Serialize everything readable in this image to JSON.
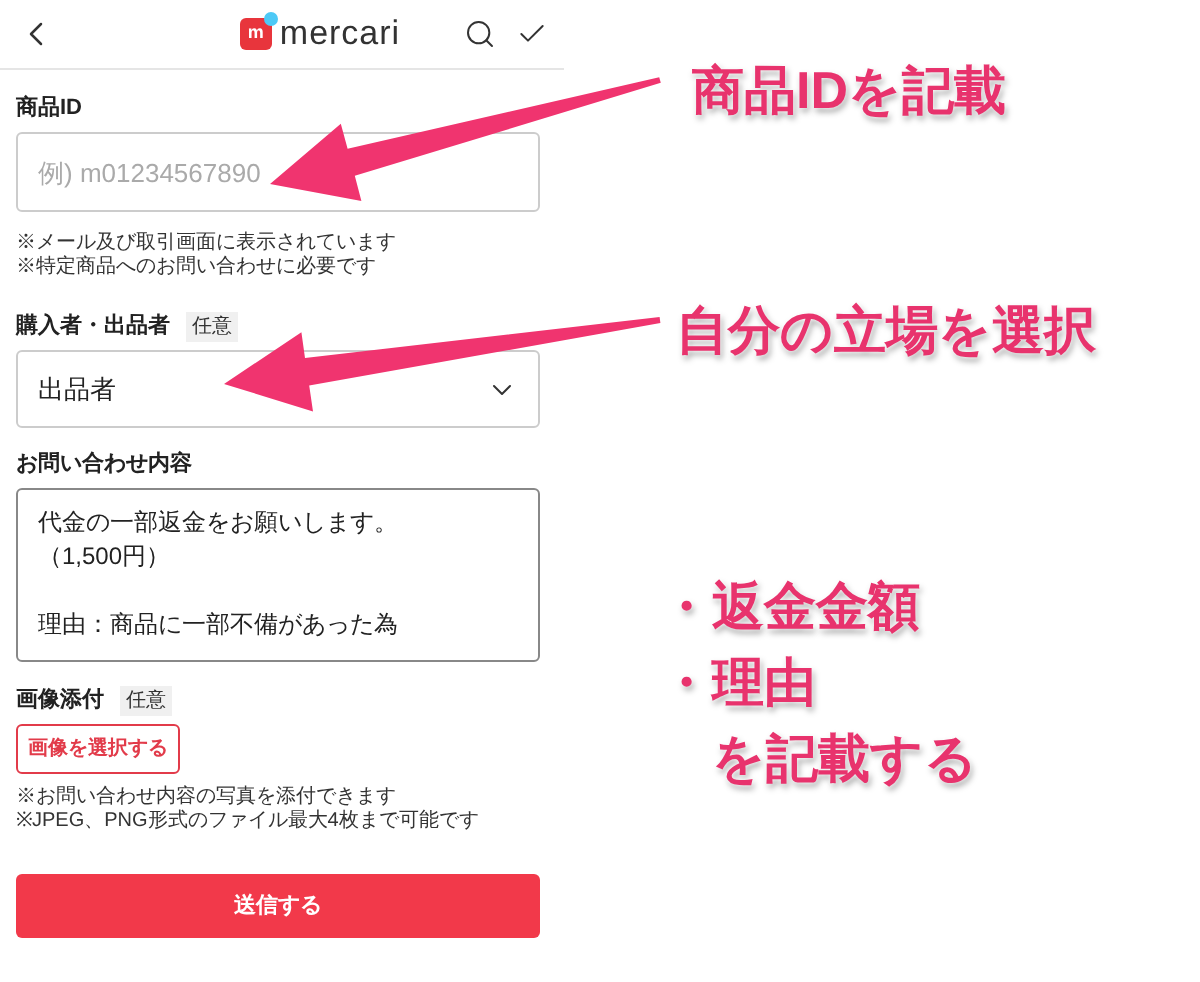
{
  "header": {
    "logo_mark": "m",
    "logo_text": "mercari"
  },
  "form": [
    {
      "kind": "input",
      "label": "商品ID",
      "placeholder": "例) m01234567890",
      "notes": [
        "※メール及び取引画面に表示されています",
        "※特定商品へのお問い合わせに必要です"
      ]
    },
    {
      "kind": "select",
      "label": "購入者・出品者",
      "badge": "任意",
      "value": "出品者"
    },
    {
      "kind": "textarea",
      "label": "お問い合わせ内容",
      "paragraphs": [
        [
          "代金の一部返金をお願いします。",
          "（1,500円）"
        ],
        [
          "理由：商品に一部不備があった為"
        ]
      ]
    },
    {
      "kind": "upload",
      "label": "画像添付",
      "badge": "任意",
      "button": "画像を選択する",
      "notes": [
        "※お問い合わせ内容の写真を添付できます",
        "※JPEG、PNG形式のファイル最大4枚まで可能です"
      ]
    }
  ],
  "submit": "送信する",
  "annotations": [
    {
      "lines": [
        "商品IDを記載"
      ]
    },
    {
      "lines": [
        "自分の立場を選択"
      ]
    },
    {
      "lines": [
        "・返金金額",
        "・理由",
        "　を記載する"
      ]
    }
  ]
}
